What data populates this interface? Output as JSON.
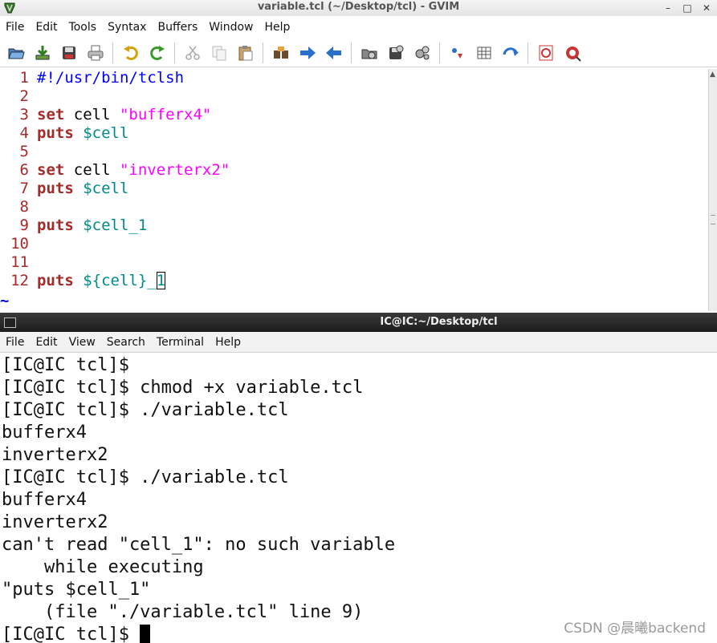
{
  "gvim": {
    "title": "variable.tcl (~/Desktop/tcl) - GVIM",
    "window_buttons": [
      "–",
      "□",
      "✕"
    ],
    "menu": [
      "File",
      "Edit",
      "Tools",
      "Syntax",
      "Buffers",
      "Window",
      "Help"
    ],
    "toolbar_icons": [
      "open-icon",
      "save-icon",
      "save-all-icon",
      "print-icon",
      "undo-icon",
      "redo-icon",
      "cut-icon",
      "copy-icon",
      "paste-icon",
      "find-replace-icon",
      "find-next-icon",
      "find-prev-icon",
      "load-session-icon",
      "save-session-icon",
      "run-script-icon",
      "make-icon",
      "shell-icon",
      "tags-jump-icon",
      "help-icon",
      "find-help-icon"
    ],
    "lines": [
      {
        "n": "1",
        "a": "#!/usr/bin/tclsh",
        "b": "",
        "c": ""
      },
      {
        "n": "2",
        "a": "",
        "b": "",
        "c": ""
      },
      {
        "n": "3",
        "a": "set",
        "b": " cell ",
        "c": "\"bufferx4\""
      },
      {
        "n": "4",
        "a": "puts",
        "b": " ",
        "c": "$cell"
      },
      {
        "n": "5",
        "a": "",
        "b": "",
        "c": ""
      },
      {
        "n": "6",
        "a": "set",
        "b": " cell ",
        "c": "\"inverterx2\""
      },
      {
        "n": "7",
        "a": "puts",
        "b": " ",
        "c": "$cell"
      },
      {
        "n": "8",
        "a": "",
        "b": "",
        "c": ""
      },
      {
        "n": "9",
        "a": "puts",
        "b": " ",
        "c": "$cell_1"
      },
      {
        "n": "10",
        "a": "",
        "b": "",
        "c": ""
      },
      {
        "n": "11",
        "a": "",
        "b": "",
        "c": ""
      },
      {
        "n": "12",
        "a": "puts",
        "b": " ",
        "c": "${cell}_",
        "d": "1"
      }
    ],
    "tilde": "~"
  },
  "terminal": {
    "title": "IC@IC:~/Desktop/tcl",
    "menu": [
      "File",
      "Edit",
      "View",
      "Search",
      "Terminal",
      "Help"
    ],
    "lines": [
      "[IC@IC tcl]$",
      "[IC@IC tcl]$ chmod +x variable.tcl",
      "[IC@IC tcl]$ ./variable.tcl",
      "bufferx4",
      "inverterx2",
      "[IC@IC tcl]$ ./variable.tcl",
      "bufferx4",
      "inverterx2",
      "can't read \"cell_1\": no such variable",
      "    while executing",
      "\"puts $cell_1\"",
      "    (file \"./variable.tcl\" line 9)",
      "[IC@IC tcl]$ "
    ]
  },
  "watermark": "CSDN @晨曦backend"
}
